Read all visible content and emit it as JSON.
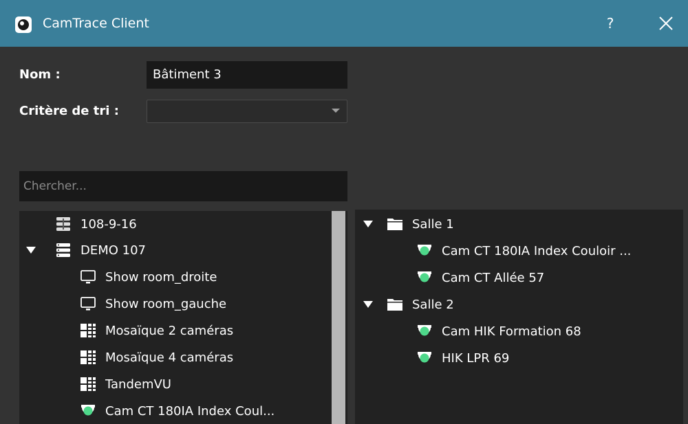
{
  "window": {
    "title": "CamTrace Client",
    "help_label": "?"
  },
  "form": {
    "name_label": "Nom :",
    "name_value": "Bâtiment 3",
    "sort_label": "Critère de tri :",
    "sort_value": ""
  },
  "search": {
    "placeholder": "Chercher..."
  },
  "left_tree": [
    {
      "label": "108-9-16",
      "icon": "server-icon"
    },
    {
      "label": "DEMO 107",
      "icon": "server-icon",
      "expanded": true
    },
    {
      "label": "Show room_droite",
      "icon": "monitor-icon"
    },
    {
      "label": "Show room_gauche",
      "icon": "monitor-icon"
    },
    {
      "label": "Mosaïque 2 caméras",
      "icon": "mosaic-icon"
    },
    {
      "label": "Mosaïque 4 caméras",
      "icon": "mosaic-icon"
    },
    {
      "label": "TandemVU",
      "icon": "mosaic-icon"
    },
    {
      "label": "Cam CT 180IA Index Coul...",
      "icon": "camera-icon"
    }
  ],
  "right_tree": [
    {
      "label": "Salle 1",
      "icon": "folder-icon",
      "expanded": true
    },
    {
      "label": "Cam CT 180IA Index Couloir ...",
      "icon": "camera-icon"
    },
    {
      "label": "Cam CT Allée 57",
      "icon": "camera-icon"
    },
    {
      "label": "Salle 2",
      "icon": "folder-icon",
      "expanded": true
    },
    {
      "label": "Cam HIK Formation 68",
      "icon": "camera-icon"
    },
    {
      "label": "HIK LPR 69",
      "icon": "camera-icon"
    }
  ],
  "colors": {
    "titlebar": "#3a7f9a",
    "background": "#333333",
    "panel": "#222222",
    "camera_status": "#4ed88a"
  }
}
